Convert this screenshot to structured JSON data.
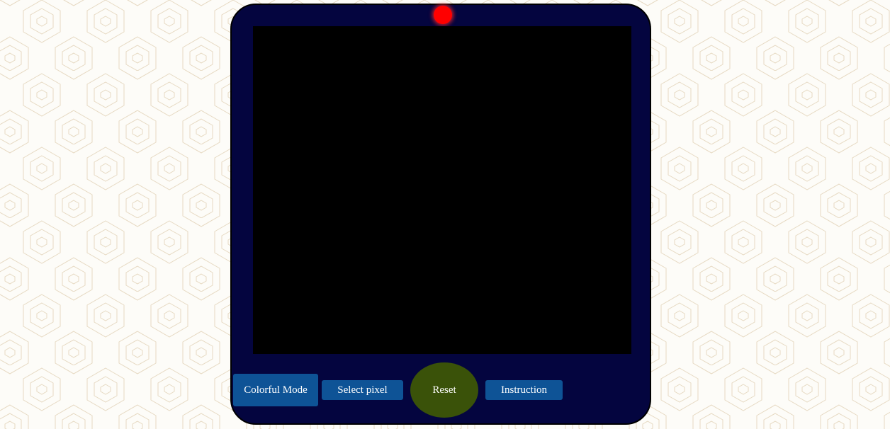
{
  "background": {
    "pattern": "hexagon-outline",
    "pattern_color": "#e6d9c2",
    "base_color": "#fdfcf8"
  },
  "device": {
    "body_color": "#04053f",
    "screen_color": "#000000",
    "indicator": {
      "icon": "status-led-icon",
      "color": "#ff0000"
    }
  },
  "controls": {
    "colorful_mode_label": "Colorful Mode",
    "select_pixel_label": "Select pixel",
    "reset_label": "Reset",
    "instruction_label": "Instruction",
    "button_color": "#0e5396",
    "reset_color": "#3a5209"
  }
}
